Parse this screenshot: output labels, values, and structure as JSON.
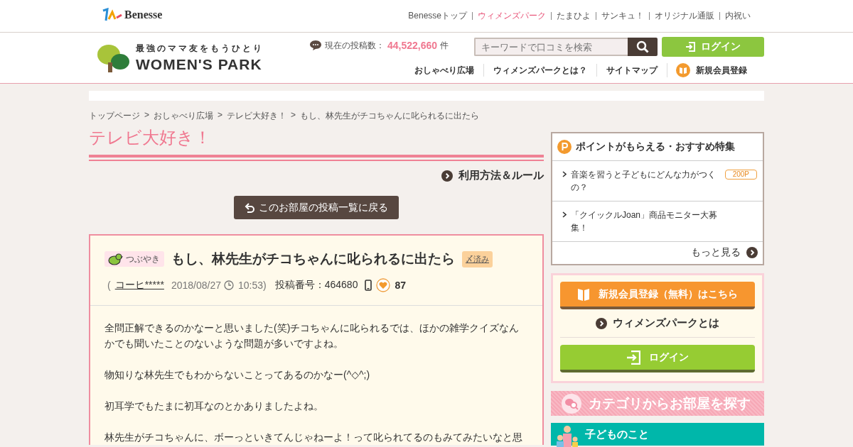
{
  "top_bar": {
    "brand": "Benesse",
    "links": [
      {
        "label": "Benesseトップ",
        "selected": false
      },
      {
        "label": "ウィメンズパーク",
        "selected": true
      },
      {
        "label": "たまひよ",
        "selected": false
      },
      {
        "label": "サンキュ！",
        "selected": false
      },
      {
        "label": "オリジナル通販",
        "selected": false
      },
      {
        "label": "内祝い",
        "selected": false
      }
    ]
  },
  "header": {
    "tagline": "最強のママ友をもうひとり",
    "site_name": "WOMEN'S PARK",
    "post_count_label": "現在の投稿数：",
    "post_count": "44,522,660",
    "post_count_unit": "件",
    "search": {
      "placeholder": "キーワードで口コミを検索"
    },
    "login_button": "ログイン",
    "nav": [
      "おしゃべり広場",
      "ウィメンズパークとは？",
      "サイトマップ"
    ],
    "register_link": "新規会員登録"
  },
  "breadcrumb": [
    "トップページ",
    "おしゃべり広場",
    "テレビ大好き！",
    "もし、林先生がチコちゃんに叱られるに出たら"
  ],
  "breadcrumb_separator": ">",
  "room_title": "テレビ大好き！",
  "rules_link": "利用方法＆ルール",
  "back_button": "このお部屋の投稿一覧に戻る",
  "post": {
    "tag": "つぶやき",
    "title": "もし、林先生がチコちゃんに叱られるに出たら",
    "closed_badge": "〆済み",
    "meta_open": "(",
    "author": "コーヒ*****",
    "date": "2018/08/27",
    "time": "10:53)",
    "post_number": "投稿番号：464680",
    "likes": "87",
    "paragraphs": [
      "全問正解できるのかなーと思いました(笑)チコちゃんに叱られるでは、ほかの雑学クイズなんかでも聞いたことのないような問題が多いですよね。",
      "物知りな林先生でもわからないことってあるのかなー(^◇^;)",
      "初耳学でもたまに初耳なのとかありましたよね。",
      "林先生がチコちゃんに、ボーっといきてんじゃねーよ！って叱られてるのもみてみたいなと思"
    ]
  },
  "sidebar": {
    "points_box": {
      "title": "ポイントがもらえる・おすすめ特集",
      "items": [
        {
          "text": "音楽を習うと子どもにどんな力がつくの？",
          "badge": "200P"
        },
        {
          "text": "「クイックルJoan」商品モニター大募集！"
        }
      ],
      "more": "もっと見る"
    },
    "member_box": {
      "register_button": "新規会員登録（無料）はこちら",
      "about_link": "ウィメンズパークとは",
      "login_button": "ログイン"
    },
    "category": {
      "title": "カテゴリからお部屋を探す",
      "items": [
        {
          "label": "子どものこと"
        }
      ]
    }
  }
}
